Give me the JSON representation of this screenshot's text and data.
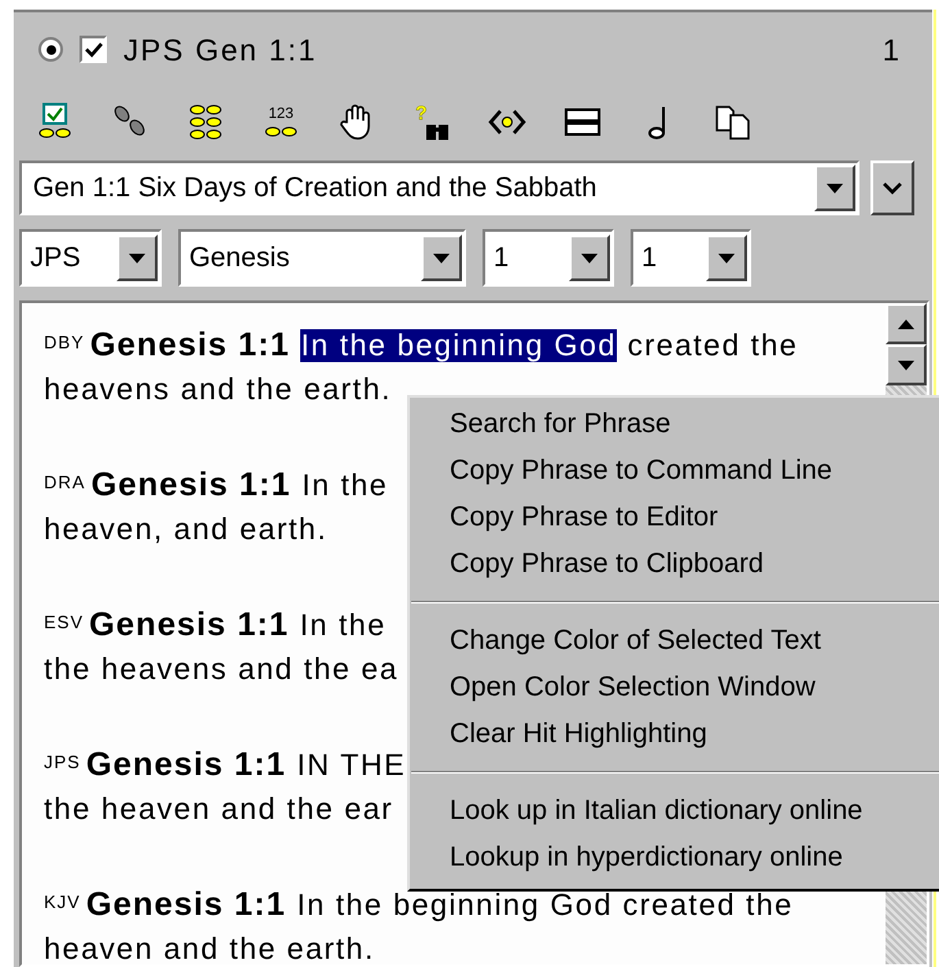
{
  "pane": {
    "radio_selected": true,
    "checked": true,
    "title": "JPS Gen 1:1",
    "number": "1"
  },
  "toolbar": {
    "numbers_icon_text": "123",
    "help_icon_text": "?"
  },
  "heading_combo": {
    "value": "Gen 1:1 Six Days of Creation and the Sabbath"
  },
  "selectors": [
    {
      "value": "JPS"
    },
    {
      "value": "Genesis"
    },
    {
      "value": "1"
    },
    {
      "value": "1"
    }
  ],
  "verses": [
    {
      "version": "DBY",
      "reference": "Genesis 1:1",
      "lines": [
        [
          {
            "text": "In the beginning God",
            "selected": true
          },
          {
            "text": "created the",
            "selected": false
          }
        ],
        [
          {
            "text": "heavens and the earth.",
            "selected": false
          }
        ]
      ]
    },
    {
      "version": "DRA",
      "reference": "Genesis 1:1",
      "lines": [
        [
          {
            "text": "In the",
            "selected": false
          }
        ],
        [
          {
            "text": "heaven, and earth.",
            "selected": false
          }
        ]
      ]
    },
    {
      "version": "ESV",
      "reference": "Genesis 1:1",
      "lines": [
        [
          {
            "text": "In the",
            "selected": false
          }
        ],
        [
          {
            "text": "the heavens and the ea",
            "selected": false
          }
        ]
      ]
    },
    {
      "version": "JPS",
      "reference": "Genesis 1:1",
      "lines": [
        [
          {
            "text": "IN THE",
            "selected": false
          }
        ],
        [
          {
            "text": "the heaven and the ear",
            "selected": false
          }
        ]
      ]
    },
    {
      "version": "KJV",
      "reference": "Genesis 1:1",
      "lines": [
        [
          {
            "text": "In the beginning God created the",
            "selected": false
          }
        ],
        [
          {
            "text": "heaven and the earth.",
            "selected": false
          }
        ]
      ]
    }
  ],
  "context_menu": {
    "groups": [
      [
        "Search for Phrase",
        "Copy Phrase to Command Line",
        "Copy Phrase to Editor",
        "Copy Phrase to Clipboard"
      ],
      [
        "Change Color of Selected Text",
        "Open Color Selection Window",
        "Clear Hit Highlighting"
      ],
      [
        "Look up in Italian dictionary online",
        "Lookup in hyperdictionary online"
      ]
    ]
  }
}
